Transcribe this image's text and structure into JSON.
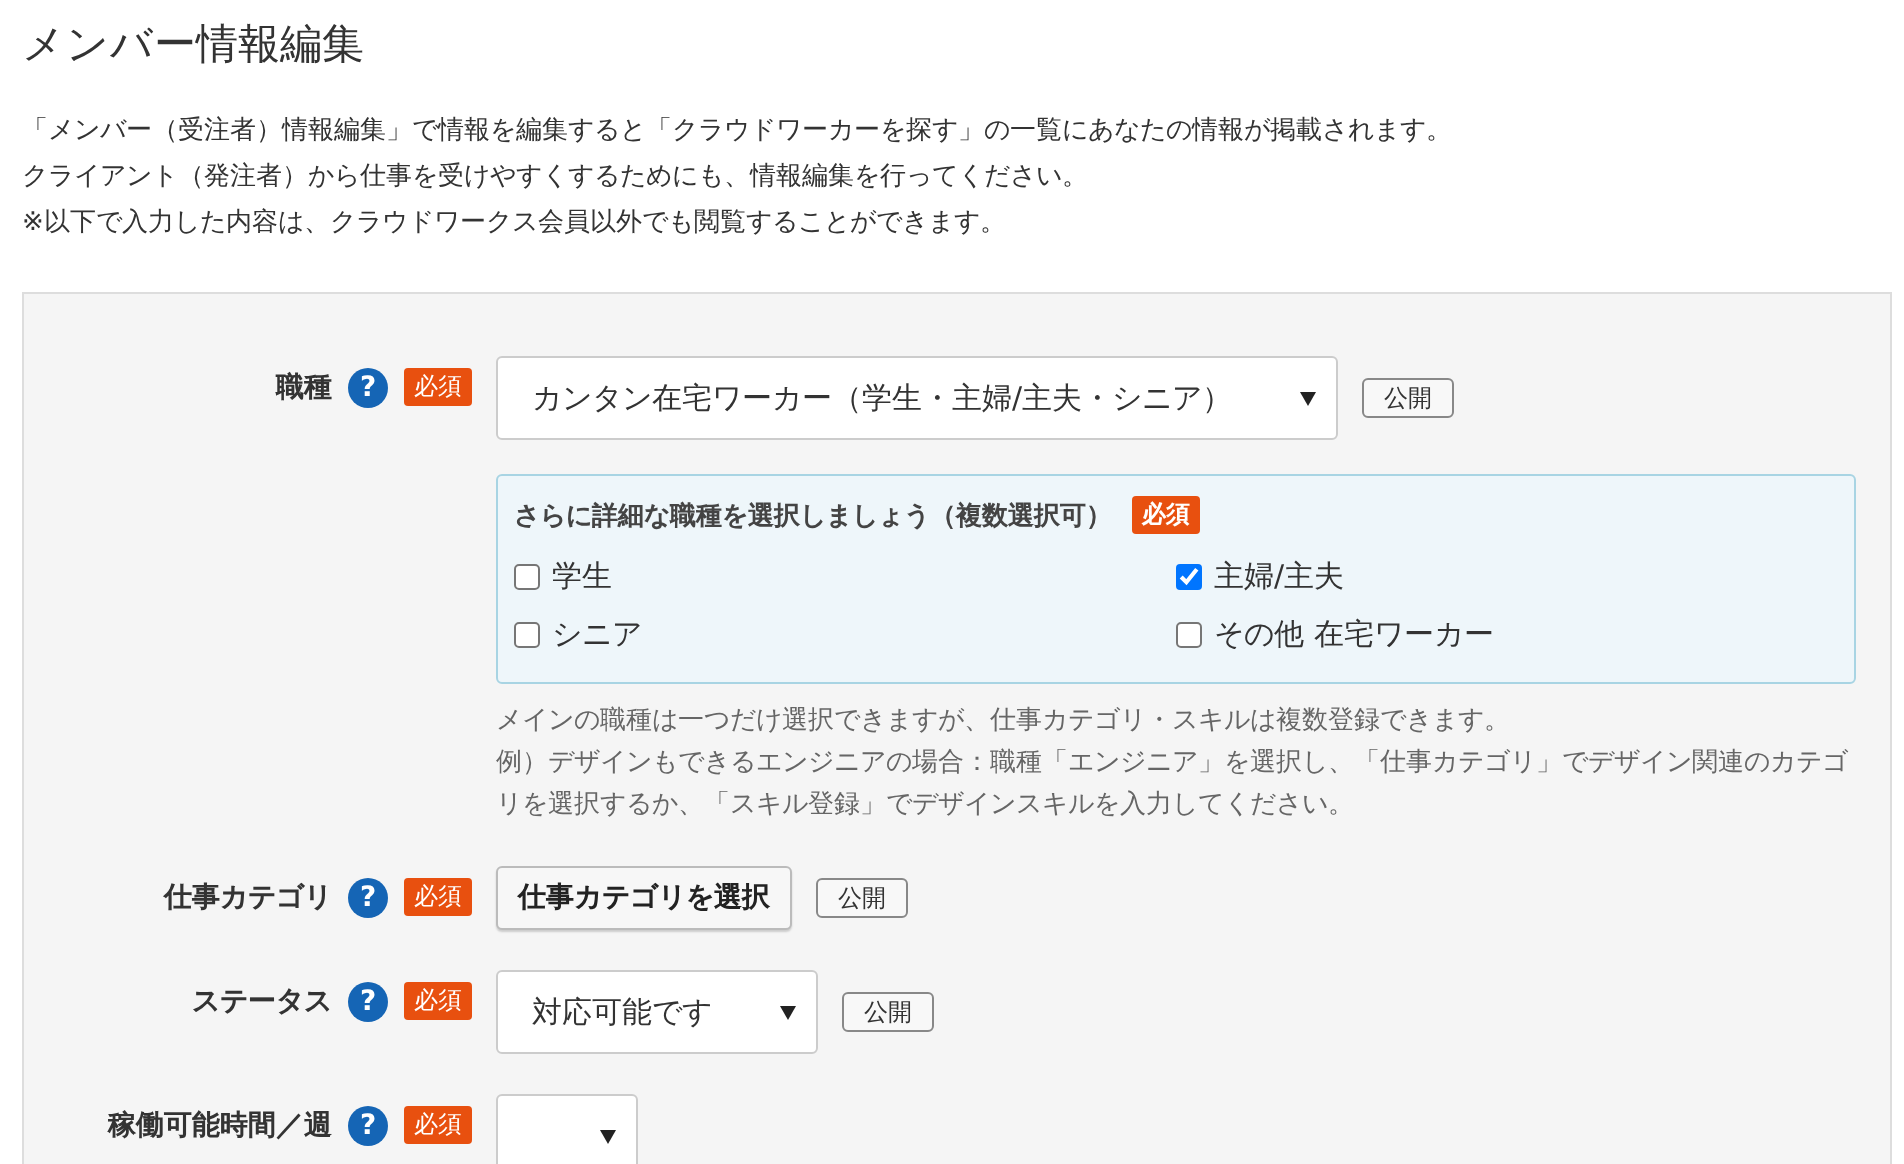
{
  "page": {
    "title": "メンバー情報編集",
    "intro": [
      "「メンバー（受注者）情報編集」で情報を編集すると「クラウドワーカーを探す」の一覧にあなたの情報が掲載されます。",
      "クライアント（発注者）から仕事を受けやすくするためにも、情報編集を行ってください。",
      "※以下で入力した内容は、クラウドワークス会員以外でも閲覧することができます。"
    ]
  },
  "form": {
    "rows": [
      {
        "kind": "select",
        "label": "職種",
        "help": "?",
        "badge": "必須",
        "value": "カンタン在宅ワーカー（学生・主婦/主夫・シニア）",
        "visibility": "公開",
        "detail": {
          "title": "さらに詳細な職種を選択しましょう（複数選択可）",
          "badge": "必須",
          "options": [
            {
              "label": "学生",
              "checked": false
            },
            {
              "label": "主婦/主夫",
              "checked": true
            },
            {
              "label": "シニア",
              "checked": false
            },
            {
              "label": "その他 在宅ワーカー",
              "checked": false
            }
          ]
        },
        "notes": [
          "メインの職種は一つだけ選択できますが、仕事カテゴリ・スキルは複数登録できます。",
          "例）デザインもできるエンジニアの場合：職種「エンジニア」を選択し、「仕事カテゴリ」でデザイン関連のカテゴリを選択するか、「スキル登録」でデザインスキルを入力してください。"
        ]
      },
      {
        "kind": "button",
        "label": "仕事カテゴリ",
        "help": "?",
        "badge": "必須",
        "value": "仕事カテゴリを選択",
        "visibility": "公開"
      },
      {
        "kind": "select",
        "label": "ステータス",
        "help": "?",
        "badge": "必須",
        "value": "対応可能です",
        "visibility": "公開"
      },
      {
        "kind": "select",
        "label": "稼働可能時間／週",
        "help": "?",
        "badge": "必須"
      }
    ]
  }
}
